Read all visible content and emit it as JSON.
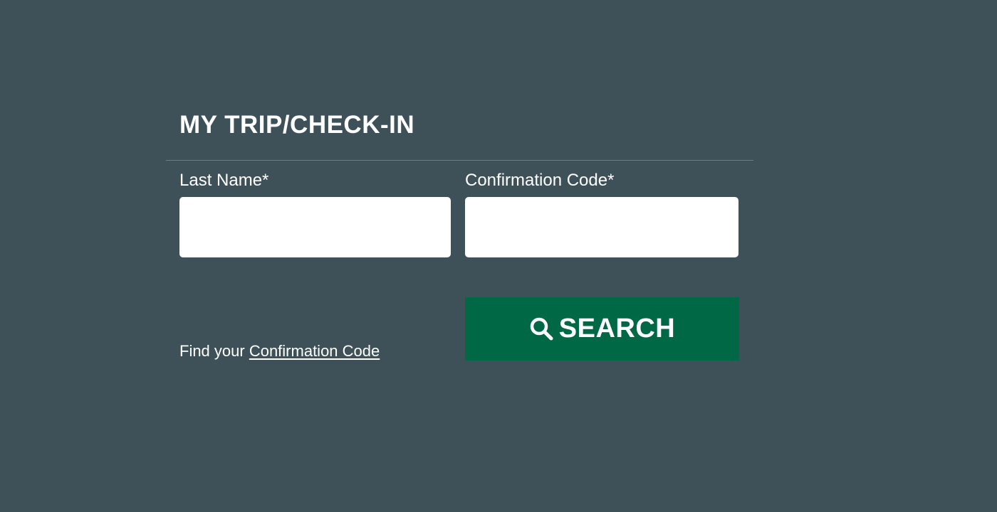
{
  "checkin": {
    "title": "MY TRIP/CHECK-IN",
    "last_name": {
      "label": "Last Name*",
      "value": "",
      "placeholder": ""
    },
    "confirmation_code": {
      "label": "Confirmation Code*",
      "value": "",
      "placeholder": ""
    },
    "search_button": {
      "label": "SEARCH",
      "icon": "search-icon"
    },
    "help": {
      "prefix": "Find your ",
      "link_text": "Confirmation Code"
    }
  },
  "colors": {
    "background": "#3e5159",
    "button": "#006845",
    "text": "#ffffff",
    "input_background": "#ffffff"
  }
}
